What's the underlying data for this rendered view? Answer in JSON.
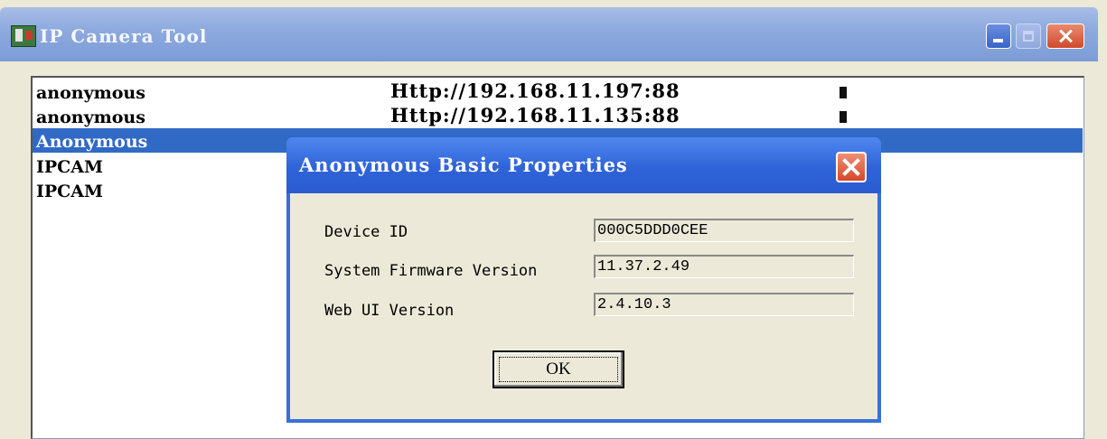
{
  "window": {
    "title": "IP Camera Tool",
    "app_icon": "camera-tool-icon",
    "controls": [
      "minimize-icon",
      "maximize-icon",
      "close-icon"
    ]
  },
  "devices": [
    {
      "name": "anonymous",
      "url": "Http://192.168.11.197:88",
      "flag": "▮",
      "selected": false
    },
    {
      "name": "anonymous",
      "url": "Http://192.168.11.135:88",
      "flag": "▮",
      "selected": false
    },
    {
      "name": "Anonymous",
      "url": "",
      "flag": "",
      "selected": true
    },
    {
      "name": "IPCAM",
      "url": "",
      "flag": "",
      "selected": false
    },
    {
      "name": "IPCAM",
      "url": "",
      "flag": "",
      "selected": false
    }
  ],
  "dialog": {
    "title": "Anonymous Basic Properties",
    "properties": [
      {
        "label": "Device ID",
        "value": "000C5DDD0CEE"
      },
      {
        "label": "System Firmware Version",
        "value": "11.37.2.49"
      },
      {
        "label": "Web UI Version",
        "value": "2.4.10.3"
      }
    ],
    "ok_label": "OK"
  },
  "colors": {
    "selection": "#316ac5",
    "dialog_title": "#2f63d8",
    "window_title": "#8eaadf",
    "face": "#ece9d8"
  }
}
